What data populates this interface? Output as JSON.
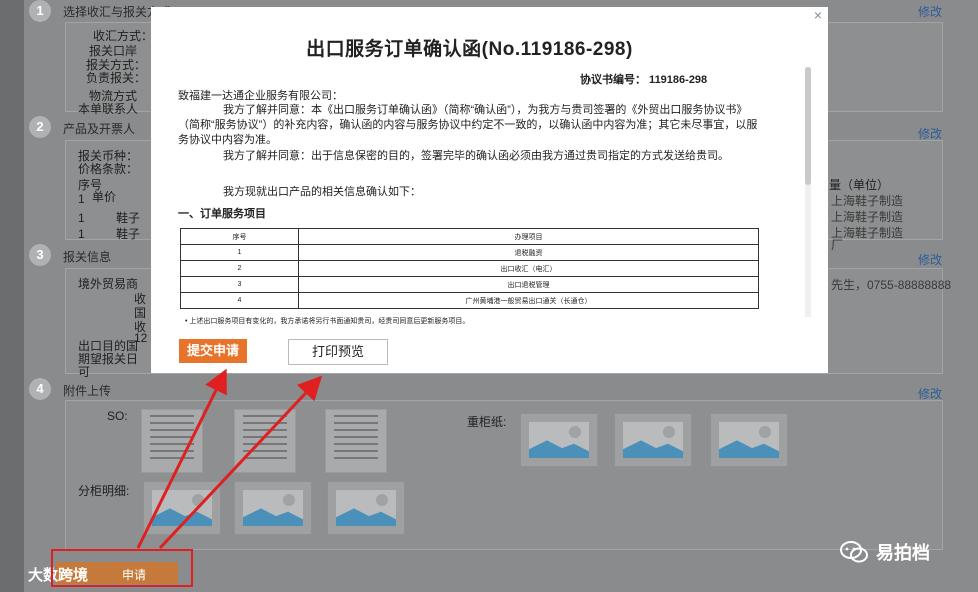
{
  "background": {
    "steps": [
      {
        "num": "1",
        "title": "选择收汇与报关方式"
      },
      {
        "num": "2",
        "title": "产品及开票人"
      },
      {
        "num": "3",
        "title": "报关信息"
      },
      {
        "num": "4",
        "title": "附件上传"
      }
    ],
    "edit_label": "修改",
    "step1_fields": [
      "收汇方式：",
      "报关口岸",
      "报关方式：",
      "负责报关：",
      "物流方式",
      "本单联系人"
    ],
    "step2_fields": [
      "报关币种：",
      "价格条款：",
      "序号",
      "1",
      "1",
      "1"
    ],
    "step2_items": [
      "单价",
      "鞋子",
      "鞋子"
    ],
    "step2_right_header": "量（单位）",
    "step2_right_rows": [
      "上海鞋子制造",
      "上海鞋子制造",
      "上海鞋子制造"
    ],
    "step2_right_extra": "厂",
    "step3_fields": [
      "境外贸易商",
      "收",
      "国",
      "收",
      "12",
      "出口目的国",
      "期望报关日",
      "可"
    ],
    "step3_contact": "先生，0755-88888888",
    "step4_so_label": "SO:",
    "step4_container_label": "重柜纸:",
    "step4_split_label": "分柜明细:"
  },
  "modal": {
    "title": "出口服务订单确认函(No.119186-298)",
    "close": "×",
    "agreement_no": "协议书编号：  119186-298",
    "greeting": "致福建一达通企业服务有限公司：",
    "para1": "我方了解并同意：本《出口服务订单确认函》（简称“确认函”），为我方与贵司签署的《外贸出口服务协议书》（简称“服务协议”）的补充内容，确认函的内容与服务协议中约定不一致的，以确认函中内容为准；其它未尽事宜，以服务协议中内容为准。",
    "para2": "我方了解并同意：出于信息保密的目的，签署完毕的确认函必须由我方通过贵司指定的方式发送给贵司。",
    "para3": "我方现就出口产品的相关信息确认如下：",
    "section1": "一、订单服务项目",
    "table_headers": [
      "序号",
      "办理项目"
    ],
    "table_rows": [
      [
        "1",
        "退税融资"
      ],
      [
        "2",
        "出口收汇（电汇）"
      ],
      [
        "3",
        "出口退税管理"
      ],
      [
        "4",
        "广州黄埔港一般贸易出口通关（长通仓）"
      ]
    ],
    "footnote": "• 上述出口服务项目有变化的，我方承诺将另行书面通知贵司，经贵司同意后更新服务项目。",
    "submit_label": "提交申请",
    "print_label": "打印预览"
  },
  "overlay": {
    "watermark_text": "易拍档",
    "bottom_left_text": "大数跨境",
    "bottom_btn_text": "申请"
  },
  "colors": {
    "accent": "#e8742b",
    "link": "#2c5d9e",
    "annotation": "#e02020"
  }
}
